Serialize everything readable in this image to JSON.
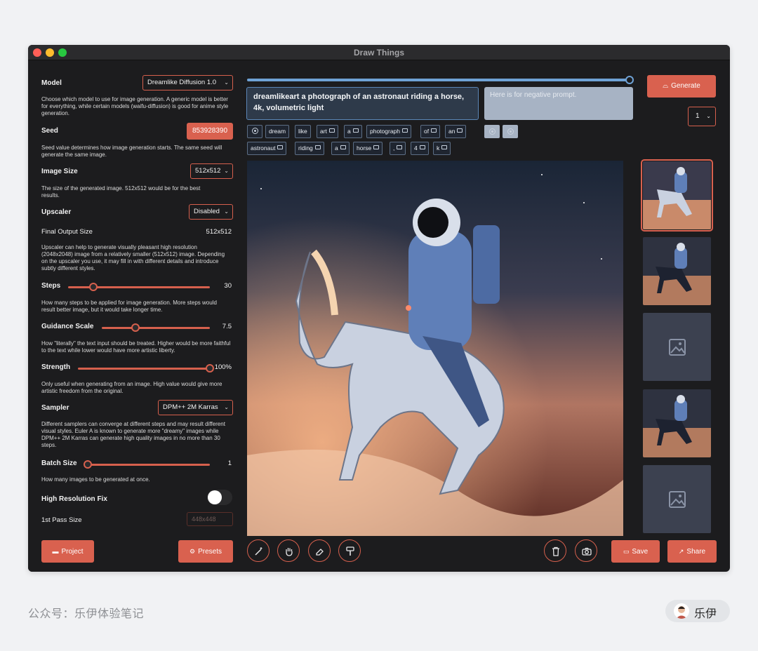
{
  "window": {
    "title": "Draw Things"
  },
  "settings": {
    "model": {
      "label": "Model",
      "value": "Dreamlike Diffusion 1.0",
      "desc": "Choose which model to use for image generation. A generic model is better for everything, while certain models (waifu-diffusion) is good for anime style generation."
    },
    "seed": {
      "label": "Seed",
      "value": "853928390",
      "desc": "Seed value determines how image generation starts. The same seed will generate the same image."
    },
    "image_size": {
      "label": "Image Size",
      "value": "512x512",
      "desc": "The size of the generated image. 512x512 would be for the best results."
    },
    "upscaler": {
      "label": "Upscaler",
      "value": "Disabled"
    },
    "final_output": {
      "label": "Final Output Size",
      "value": "512x512",
      "desc": "Upscaler can help to generate visually pleasant high resolution (2048x2048) image from a relatively smaller (512x512) image. Depending on the upscaler you use, it may fill in with different details and introduce subtly different styles."
    },
    "steps": {
      "label": "Steps",
      "value": "30",
      "fraction": 0.18,
      "desc": "How many steps to be applied for image generation. More steps would result better image, but it would take longer time."
    },
    "guidance": {
      "label": "Guidance Scale",
      "value": "7.5",
      "fraction": 0.31,
      "desc": "How \"literally\" the text input should be treated. Higher would be more faithful to the text while lower would have more artistic liberty."
    },
    "strength": {
      "label": "Strength",
      "value": "100%",
      "fraction": 1.0,
      "desc": "Only useful when generating from an image. High value would give more artistic freedom from the original."
    },
    "sampler": {
      "label": "Sampler",
      "value": "DPM++ 2M Karras",
      "desc": "Different samplers can converge at different steps and may result different visual styles. Euler A is known to generate more \"dreamy\" images while DPM++ 2M Karras can generate high quality images in no more than 30 steps."
    },
    "batch_size": {
      "label": "Batch Size",
      "value": "1",
      "fraction": 0.0,
      "desc": "How many images to be generated at once."
    },
    "hires_fix": {
      "label": "High Resolution Fix",
      "enabled": false
    },
    "first_pass": {
      "label": "1st Pass Size",
      "value": "448x448"
    }
  },
  "bottom_left": {
    "project": "Project",
    "presets": "Presets"
  },
  "progress": {
    "fraction": 1.0
  },
  "prompt": {
    "text": "dreamlikeart a photograph of an astronaut riding a horse, 4k, volumetric light"
  },
  "negative_prompt": {
    "placeholder": "Here is for negative prompt."
  },
  "tokens_row1": [
    "dream",
    "like",
    "art",
    "a",
    "photograph",
    "of",
    "an"
  ],
  "tokens_row2": [
    "astronaut",
    "riding",
    "a",
    "horse",
    ",",
    "4",
    "k"
  ],
  "generate": {
    "label": "Generate",
    "count": "1"
  },
  "actions": {
    "save": "Save",
    "share": "Share"
  },
  "footer": {
    "wechat": "公众号：乐伊体验笔记",
    "author": "乐伊"
  },
  "colors": {
    "accent": "#d9614f",
    "blue": "#6fa2d6",
    "panel": "#1c1c1e"
  }
}
